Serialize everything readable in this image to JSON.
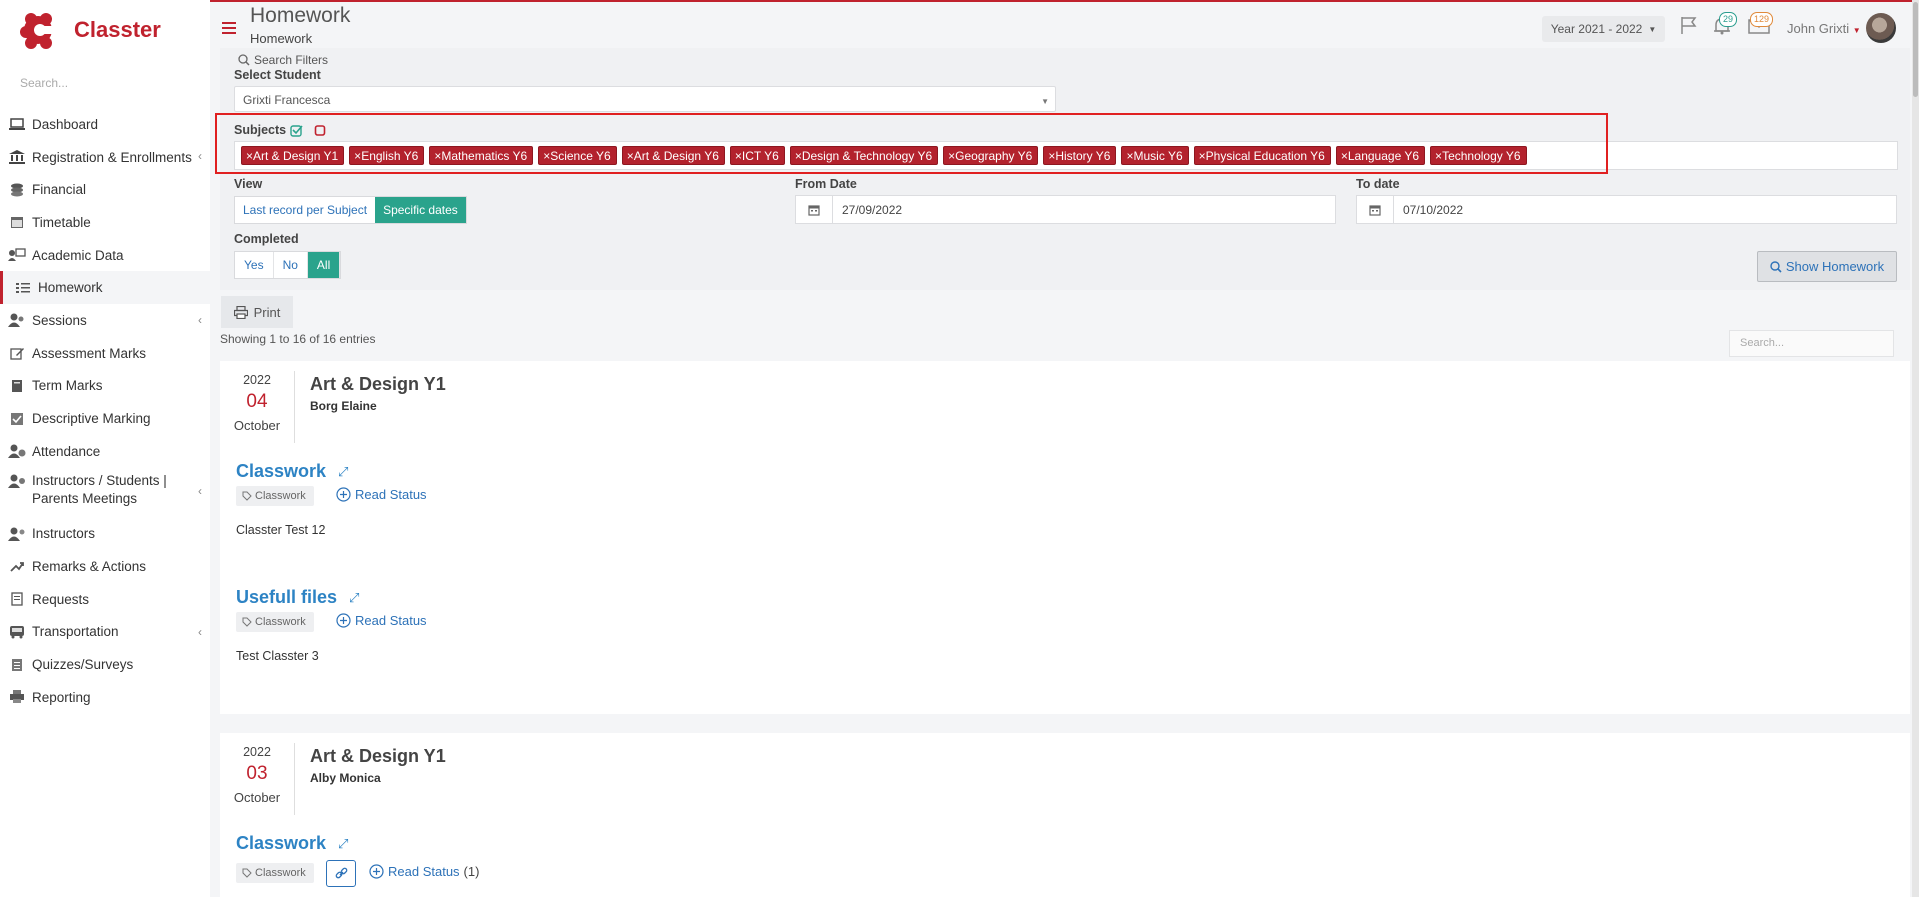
{
  "brand": {
    "name": "Classter",
    "color": "#c0222e"
  },
  "sidebar": {
    "search_placeholder": "Search...",
    "items": [
      {
        "label": "Dashboard",
        "icon": "laptop-icon"
      },
      {
        "label": "Registration & Enrollments",
        "icon": "institution-icon",
        "has_submenu": true
      },
      {
        "label": "Financial",
        "icon": "coins-icon"
      },
      {
        "label": "Timetable",
        "icon": "calendar-icon"
      },
      {
        "label": "Academic Data",
        "icon": "users-board-icon"
      },
      {
        "label": "Homework",
        "icon": "list-check-icon",
        "active": true
      },
      {
        "label": "Sessions",
        "icon": "user-group-icon",
        "has_submenu": true
      },
      {
        "label": "Assessment Marks",
        "icon": "edit-icon"
      },
      {
        "label": "Term Marks",
        "icon": "book-icon"
      },
      {
        "label": "Descriptive Marking",
        "icon": "check-square-icon"
      },
      {
        "label": "Attendance",
        "icon": "user-clock-icon"
      },
      {
        "label": "Instructors / Students | Parents Meetings",
        "icon": "people-icon",
        "has_submenu": true
      },
      {
        "label": "Instructors",
        "icon": "users-icon"
      },
      {
        "label": "Remarks & Actions",
        "icon": "shuffle-icon"
      },
      {
        "label": "Requests",
        "icon": "document-icon"
      },
      {
        "label": "Transportation",
        "icon": "bus-icon",
        "has_submenu": true
      },
      {
        "label": "Quizzes/Surveys",
        "icon": "list-icon"
      },
      {
        "label": "Reporting",
        "icon": "printer-icon"
      }
    ]
  },
  "header": {
    "title": "Homework",
    "breadcrumb": "Homework",
    "year": "Year 2021 - 2022",
    "notifications_count": "29",
    "messages_count": "129",
    "user_name": "John Grixti"
  },
  "filters": {
    "search_filters_label": "Search Filters",
    "select_student_label": "Select Student",
    "student_value": "Grixti Francesca",
    "subjects_label": "Subjects",
    "subjects": [
      "Art & Design Y1",
      "English Y6",
      "Mathematics Y6",
      "Science Y6",
      "Art & Design Y6",
      "ICT Y6",
      "Design & Technology Y6",
      "Geography Y6",
      "History Y6",
      "Music Y6",
      "Physical Education Y6",
      "Language Y6",
      "Technology Y6"
    ],
    "view_label": "View",
    "view_options": [
      "Last record per Subject",
      "Specific dates"
    ],
    "view_selected": "Specific dates",
    "from_date_label": "From Date",
    "from_date": "27/09/2022",
    "to_date_label": "To date",
    "to_date": "07/10/2022",
    "completed_label": "Completed",
    "completed_options": [
      "Yes",
      "No",
      "All"
    ],
    "completed_selected": "All",
    "show_button": "Show Homework"
  },
  "table": {
    "print_label": "Print",
    "showing": "Showing 1 to 16 of 16 entries",
    "search_placeholder": "Search..."
  },
  "records": [
    {
      "year": "2022",
      "day": "04",
      "month": "October",
      "subject": "Art & Design Y1",
      "teacher": "Borg Elaine",
      "entries": [
        {
          "title": "Classwork",
          "category": "Classwork",
          "read_status": "Read Status",
          "description": "Classter Test 12"
        },
        {
          "title": "Usefull files",
          "category": "Classwork",
          "read_status": "Read Status",
          "description": "Test Classter 3"
        }
      ]
    },
    {
      "year": "2022",
      "day": "03",
      "month": "October",
      "subject": "Art & Design Y1",
      "teacher": "Alby Monica",
      "entries": [
        {
          "title": "Classwork",
          "category": "Classwork",
          "read_status": "Read Status",
          "read_count": "(1)"
        }
      ]
    }
  ]
}
